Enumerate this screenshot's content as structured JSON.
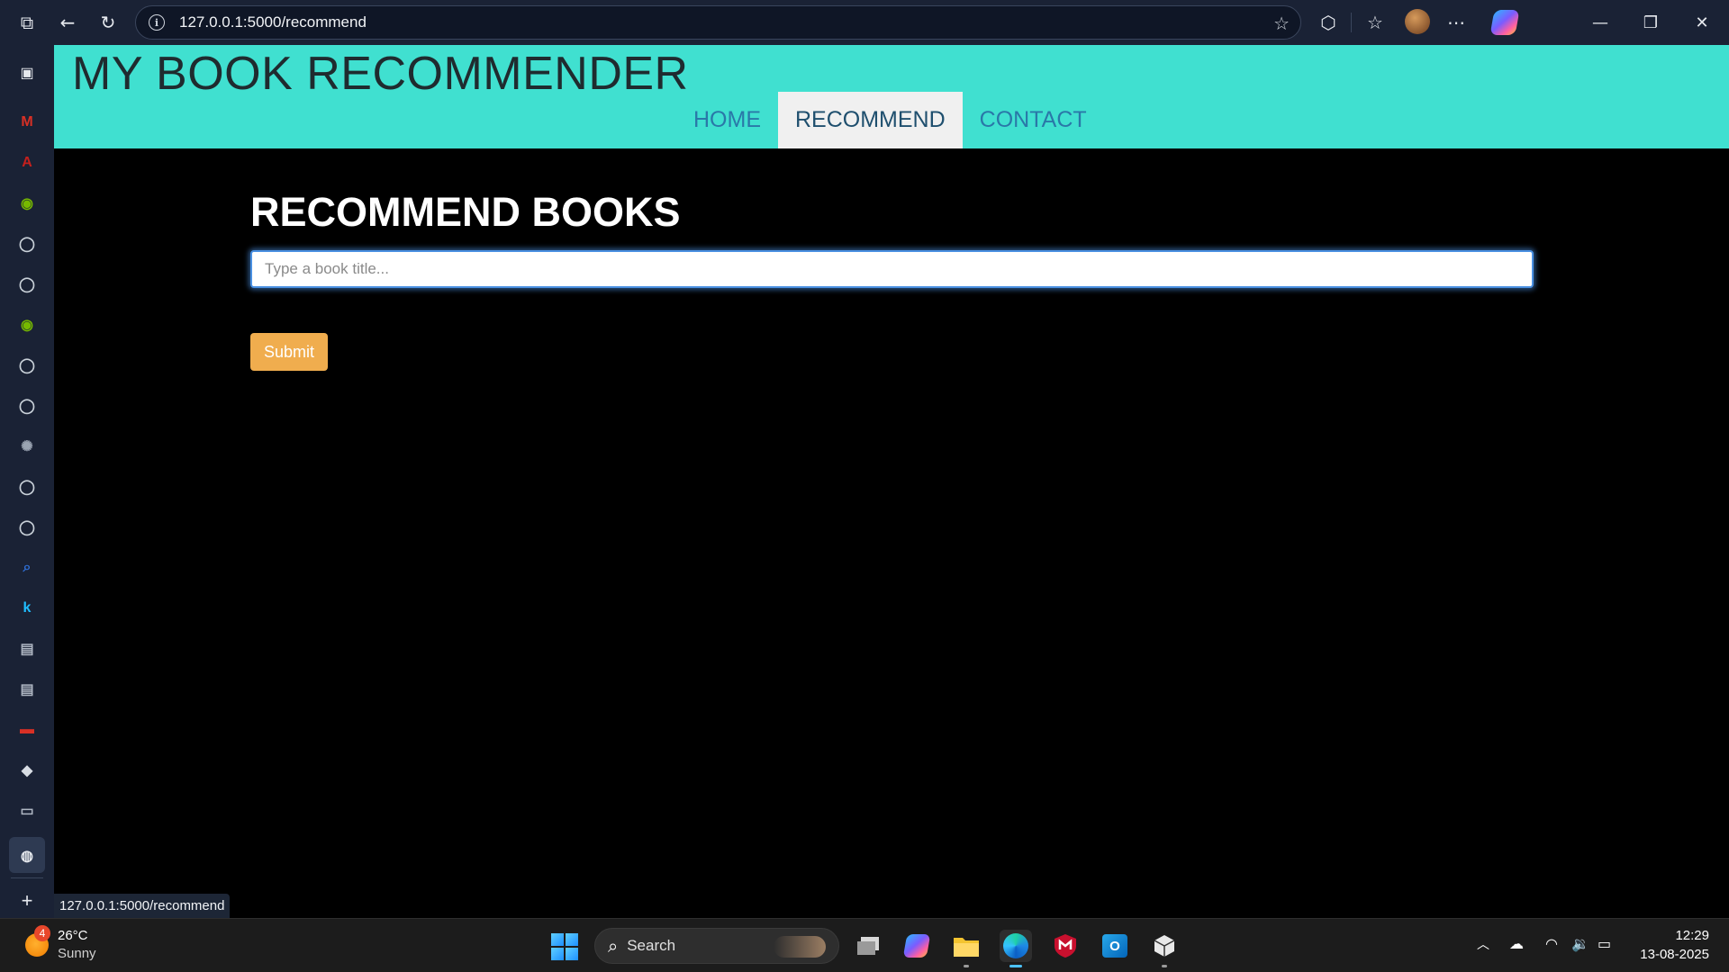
{
  "browser": {
    "url": "127.0.0.1:5000/recommend",
    "status_url": "127.0.0.1:5000/recommend"
  },
  "sidebar": {
    "items": [
      {
        "icon": "gmail-icon",
        "glyph": "M",
        "color": "#d93025"
      },
      {
        "icon": "adobe-icon",
        "glyph": "A",
        "color": "#c4201d"
      },
      {
        "icon": "nvidia-icon",
        "glyph": "◉",
        "color": "#76b900"
      },
      {
        "icon": "github-icon",
        "glyph": "◯",
        "color": "#c9d1d9"
      },
      {
        "icon": "github-icon",
        "glyph": "◯",
        "color": "#c9d1d9"
      },
      {
        "icon": "nvidia-icon",
        "glyph": "◉",
        "color": "#76b900"
      },
      {
        "icon": "github-icon",
        "glyph": "◯",
        "color": "#c9d1d9"
      },
      {
        "icon": "github-icon",
        "glyph": "◯",
        "color": "#c9d1d9"
      },
      {
        "icon": "openai-icon",
        "glyph": "✺",
        "color": "#9aa4b2"
      },
      {
        "icon": "github-icon",
        "glyph": "◯",
        "color": "#c9d1d9"
      },
      {
        "icon": "github-icon",
        "glyph": "◯",
        "color": "#c9d1d9"
      },
      {
        "icon": "search-site-icon",
        "glyph": "⌕",
        "color": "#2f6fd6"
      },
      {
        "icon": "kaggle-icon",
        "glyph": "k",
        "color": "#20beff"
      },
      {
        "icon": "page-icon",
        "glyph": "▤",
        "color": "#aeb6c2"
      },
      {
        "icon": "page-icon",
        "glyph": "▤",
        "color": "#aeb6c2"
      },
      {
        "icon": "pdf-icon",
        "glyph": "▬",
        "color": "#d93025"
      },
      {
        "icon": "box-icon",
        "glyph": "◆",
        "color": "#d8dde4"
      },
      {
        "icon": "window-icon",
        "glyph": "▭",
        "color": "#aeb6c2"
      },
      {
        "icon": "globe-icon",
        "glyph": "◍",
        "color": "#e6e9ee"
      }
    ]
  },
  "site": {
    "title": "MY BOOK RECOMMENDER",
    "nav": [
      {
        "label": "HOME",
        "active": false
      },
      {
        "label": "RECOMMEND",
        "active": true
      },
      {
        "label": "CONTACT",
        "active": false
      }
    ]
  },
  "main": {
    "heading": "RECOMMEND BOOKS",
    "input_placeholder": "Type a book title...",
    "input_value": "",
    "submit_label": "Submit"
  },
  "taskbar": {
    "weather": {
      "temp": "26°C",
      "condition": "Sunny",
      "badge": "4"
    },
    "search_label": "Search",
    "clock": {
      "time": "12:29",
      "date": "13-08-2025"
    }
  },
  "colors": {
    "header_bg": "#40e0d0",
    "nav_link": "#2a78a8",
    "submit_bg": "#f0ad4e"
  }
}
